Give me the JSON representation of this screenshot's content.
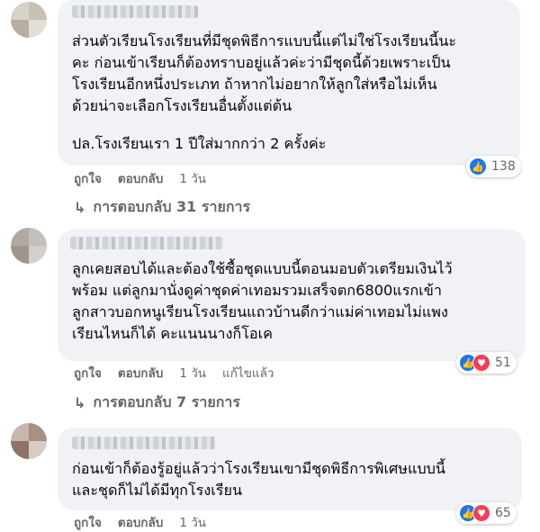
{
  "comments": [
    {
      "text": "ส่วนตัวเรียนโรงเรียนที่มีชุดพิธีการแบบนี้แต่ไม่ใช่โรงเรียนนี้นะ\nคะ ก่อนเข้าเรียนก็ต้องทราบอยู่แล้วค่ะว่ามีชุดนี้ด้วยเพราะเป็น\nโรงเรียนอีกหนึ่งประเภท ถ้าหากไม่อยากให้ลูกใส่หรือไม่เห็น\nด้วยน่าจะเลือกโรงเรียนอื่นตั้งแต่ต้น",
      "text2": "ปล.โรงเรียนเรา 1 ปีใส่มากกว่า 2 ครั้งค่ะ",
      "like": "ถูกใจ",
      "reply": "ตอบกลับ",
      "time": "1 วัน",
      "reactions": {
        "like_icon": "thumbs-up-icon",
        "count": "138"
      },
      "replies_label": "การตอบกลับ 31 รายการ"
    },
    {
      "text": "ลูกเคยสอบได้และต้องใช้ซื้อชุดแบบนี้ตอนมอบตัวเตรียมเงินไว้\nพร้อม แต่ลูกมานั่งดูค่าชุดค่าเทอมรวมเสร็จตก6800แรกเข้า\nลูกสาวบอกหนูเรียนโรงเรียนแถวบ้านดีกว่าแม่ค่าเทอมไม่แพง\nเรียนไหนก็ได้ คะแนนนางก็โอเค",
      "like": "ถูกใจ",
      "reply": "ตอบกลับ",
      "time": "1 วัน",
      "edited": "แก้ไขแล้ว",
      "reactions": {
        "like_icon": "thumbs-up-icon",
        "love_icon": "heart-icon",
        "count": "51"
      },
      "replies_label": "การตอบกลับ 7 รายการ"
    },
    {
      "text": "ก่อนเข้าก็ต้องรู้อยู่แล้วว่าโรงเรียนเขามีชุดพิธีการพิเศษแบบนี้\nและชุดก็ไม่ได้มีทุกโรงเรียน",
      "like": "ถูกใจ",
      "reply": "ตอบกลับ",
      "time": "1 วัน",
      "reactions": {
        "like_icon": "thumbs-up-icon",
        "love_icon": "heart-icon",
        "count": "65"
      }
    }
  ],
  "colors": {
    "bubble": "#f0f2f5",
    "meta": "#65676b",
    "like": "#1877f2",
    "love": "#f33e58"
  }
}
